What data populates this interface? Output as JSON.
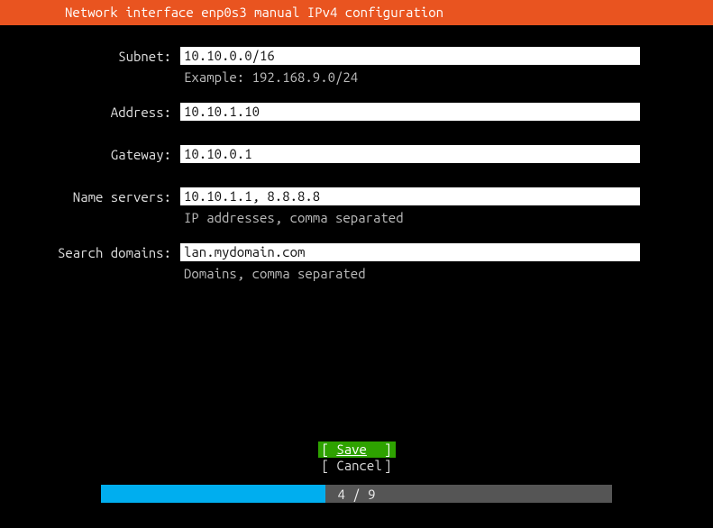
{
  "header": {
    "title": "Network interface enp0s3 manual IPv4 configuration"
  },
  "fields": {
    "subnet": {
      "label": "Subnet:",
      "value": "10.10.0.0/16",
      "hint": "Example: 192.168.9.0/24"
    },
    "address": {
      "label": "Address:",
      "value": "10.10.1.10",
      "hint": ""
    },
    "gateway": {
      "label": "Gateway:",
      "value": "10.10.0.1",
      "hint": ""
    },
    "nameservers": {
      "label": "Name servers:",
      "value": "10.10.1.1, 8.8.8.8",
      "hint": "IP addresses, comma separated"
    },
    "searchdomains": {
      "label": "Search domains:",
      "value": "lan.mydomain.com",
      "hint": "Domains, comma separated"
    }
  },
  "buttons": {
    "save": "Save",
    "cancel": "Cancel"
  },
  "progress": {
    "current": 4,
    "total": 9,
    "label": "4 / 9",
    "percent": 44
  },
  "colors": {
    "header": "#e95420",
    "save_bg": "#2ea200",
    "progress_fill": "#00aeef"
  }
}
